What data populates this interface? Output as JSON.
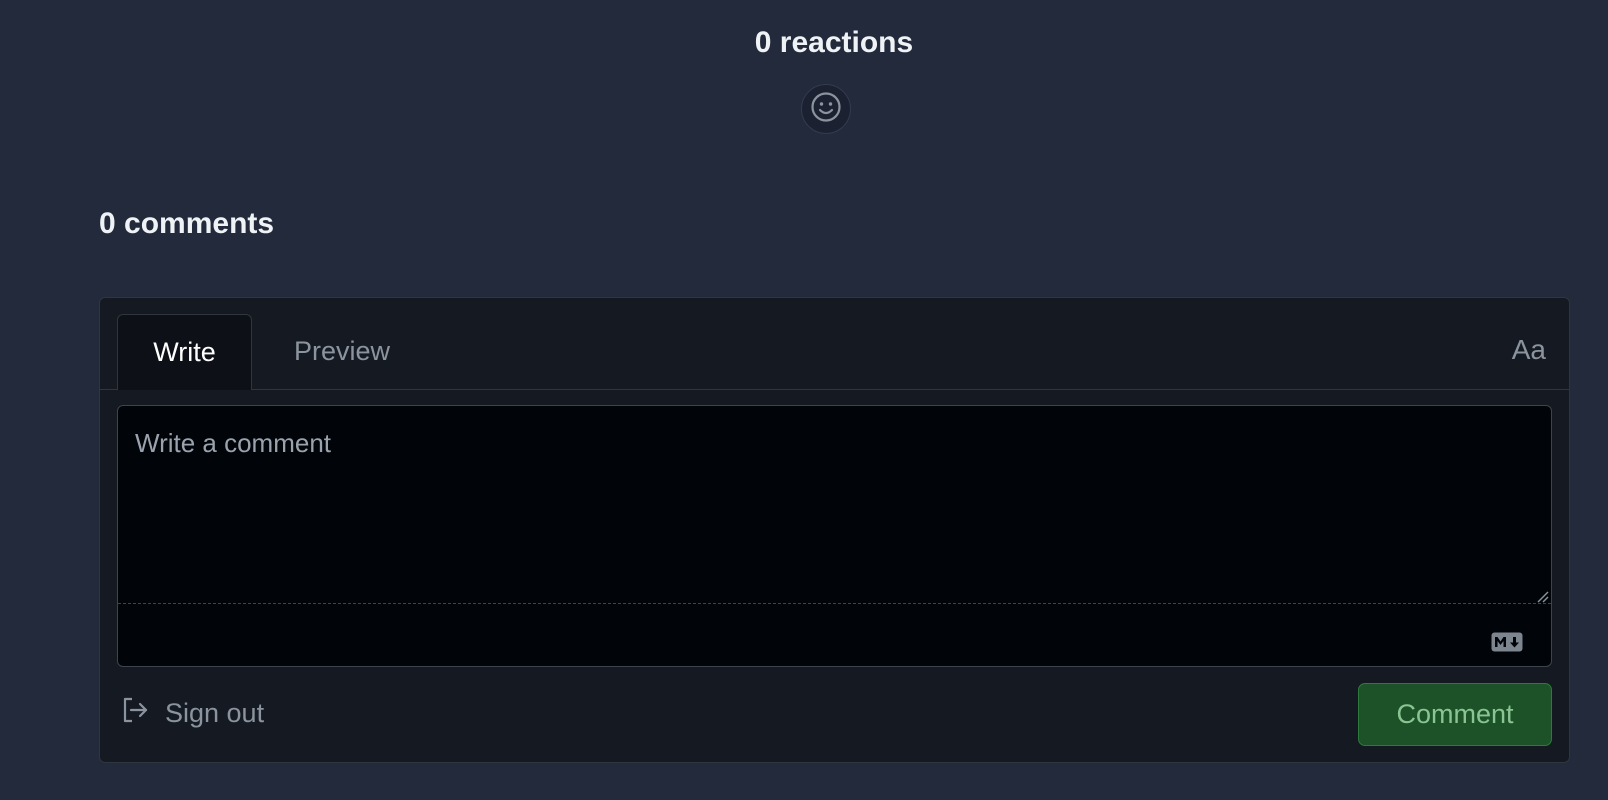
{
  "reactions": {
    "title": "0 reactions",
    "add_icon": "smiley-icon"
  },
  "comments": {
    "title": "0 comments",
    "tabs": [
      {
        "label": "Write",
        "active": true
      },
      {
        "label": "Preview",
        "active": false
      }
    ],
    "text_style_label": "Aa",
    "editor": {
      "placeholder": "Write a comment",
      "value": "",
      "markdown_icon": "markdown-icon"
    },
    "sign_out": {
      "label": "Sign out",
      "icon": "sign-out-icon"
    },
    "submit_label": "Comment"
  },
  "colors": {
    "background": "#222a3b",
    "panel": "#151a22",
    "editor": "#010409",
    "button_bg": "#1d5128",
    "button_text": "#8bc493"
  }
}
